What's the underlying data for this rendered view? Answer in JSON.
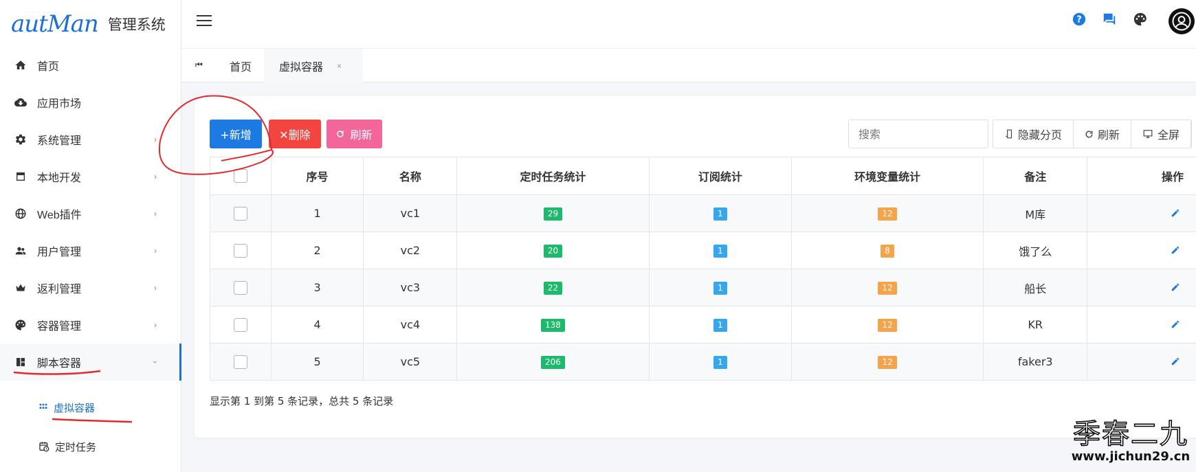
{
  "app": {
    "logo_script": "autMan",
    "logo_text": "管理系统"
  },
  "sidebar": {
    "items": [
      {
        "label": "首页",
        "icon": "home-icon",
        "has_children": false
      },
      {
        "label": "应用市场",
        "icon": "cloud-download-icon",
        "has_children": false
      },
      {
        "label": "系统管理",
        "icon": "gear-icon",
        "has_children": true
      },
      {
        "label": "本地开发",
        "icon": "window-icon",
        "has_children": true
      },
      {
        "label": "Web插件",
        "icon": "globe-icon",
        "has_children": true
      },
      {
        "label": "用户管理",
        "icon": "users-icon",
        "has_children": true
      },
      {
        "label": "返利管理",
        "icon": "crown-icon",
        "has_children": true
      },
      {
        "label": "容器管理",
        "icon": "palette-icon",
        "has_children": true
      },
      {
        "label": "脚本容器",
        "icon": "dashboard-icon",
        "has_children": true,
        "expanded": true
      }
    ],
    "subitems": [
      {
        "label": "虚拟容器",
        "icon": "dots-icon",
        "active": true
      },
      {
        "label": "定时任务",
        "icon": "calendar-clock-icon",
        "active": false
      }
    ]
  },
  "header": {
    "icons": [
      "help-icon",
      "chat-icon",
      "palette-icon",
      "avatar-icon"
    ]
  },
  "tabs": [
    {
      "label": "首页",
      "active": false
    },
    {
      "label": "虚拟容器",
      "active": true,
      "close": "×"
    }
  ],
  "toolbar": {
    "add_label": "+新增",
    "delete_label": "✕删除",
    "refresh_label": "刷新",
    "search_placeholder": "搜索",
    "tools": [
      "隐藏分页",
      "刷新",
      "全屏"
    ]
  },
  "table": {
    "headers": [
      "序号",
      "名称",
      "定时任务统计",
      "订阅统计",
      "环境变量统计",
      "备注",
      "操作"
    ],
    "rows": [
      {
        "index": "1",
        "name": "vc1",
        "cron": "29",
        "sub": "1",
        "env": "12",
        "note": "M库"
      },
      {
        "index": "2",
        "name": "vc2",
        "cron": "20",
        "sub": "1",
        "env": "8",
        "note": "饿了么"
      },
      {
        "index": "3",
        "name": "vc3",
        "cron": "22",
        "sub": "1",
        "env": "12",
        "note": "船长"
      },
      {
        "index": "4",
        "name": "vc4",
        "cron": "138",
        "sub": "1",
        "env": "12",
        "note": "KR"
      },
      {
        "index": "5",
        "name": "vc5",
        "cron": "206",
        "sub": "1",
        "env": "12",
        "note": "faker3"
      }
    ],
    "summary": "显示第 1 到第 5 条记录，总共 5 条记录"
  },
  "watermark": {
    "main": "季春二九",
    "sub": "www.jichun29.cn"
  },
  "colors": {
    "primary": "#1d7ae3",
    "danger": "#f3453f",
    "pink": "#f3669a",
    "green": "#1cbb6c",
    "blue": "#38a6ed",
    "orange": "#f6a44b",
    "annotation": "#e8262b"
  }
}
